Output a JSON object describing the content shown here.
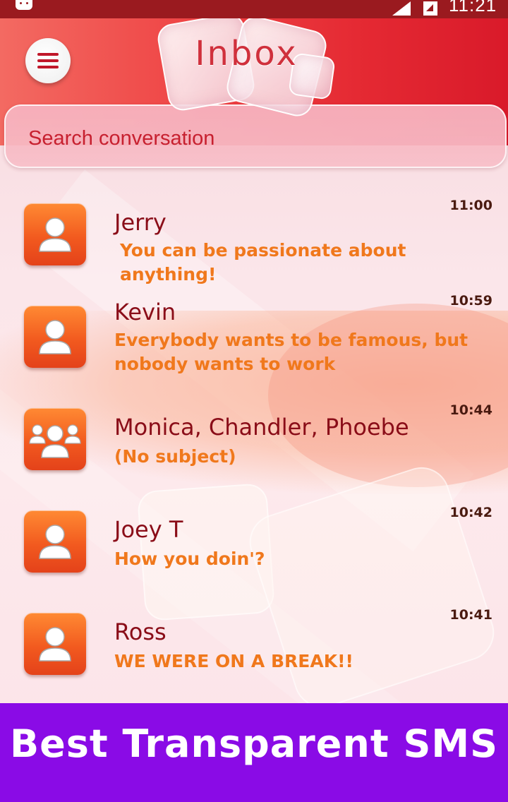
{
  "status_bar": {
    "time": "11:21",
    "icons": [
      "android-icon",
      "signal-icon",
      "battery-icon"
    ]
  },
  "header": {
    "title": "Inbox",
    "menu_icon": "hamburger-menu-icon"
  },
  "search": {
    "placeholder": "Search conversation"
  },
  "conversations": [
    {
      "name": "Jerry",
      "preview": "You can be passionate about anything!",
      "time": "11:00",
      "avatar": "person-icon"
    },
    {
      "name": "Kevin",
      "preview": "Everybody wants to be famous, but nobody wants to work",
      "time": "10:59",
      "avatar": "person-icon"
    },
    {
      "name": "Monica, Chandler, Phoebe",
      "preview": "(No subject)",
      "time": "10:44",
      "avatar": "group-icon"
    },
    {
      "name": "Joey T",
      "preview": "How you doin'?",
      "time": "10:42",
      "avatar": "person-icon"
    },
    {
      "name": "Ross",
      "preview": "WE WERE ON A BREAK!!",
      "time": "10:41",
      "avatar": "person-icon"
    }
  ],
  "footer": {
    "banner": "Best Transparent SMS"
  },
  "colors": {
    "header_red": "#e52a33",
    "name_color": "#8a0d18",
    "preview_color": "#f0781c",
    "avatar_orange": "#f25a1f",
    "footer_purple": "#8a0be6"
  }
}
